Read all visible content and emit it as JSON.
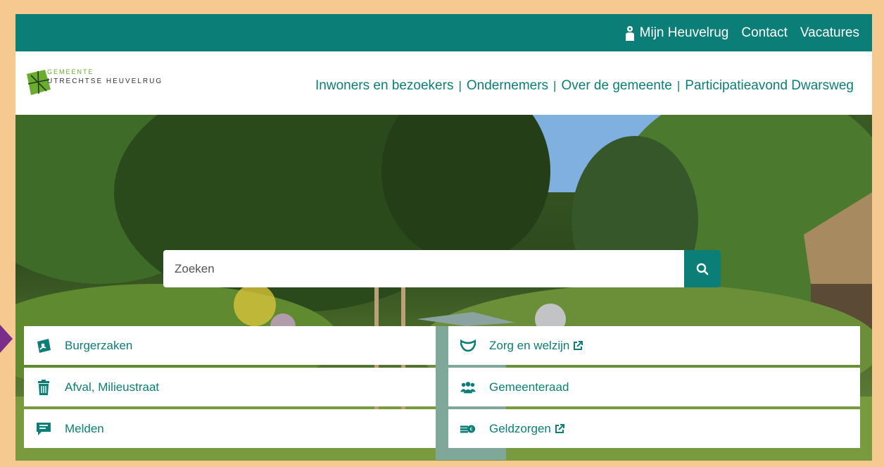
{
  "topbar": {
    "links": [
      "Mijn Heuvelrug",
      "Contact",
      "Vacatures"
    ]
  },
  "logo": {
    "line1": "GEMEENTE",
    "line2": "UTRECHTSE HEUVELRUG"
  },
  "mainnav": {
    "items": [
      "Inwoners en bezoekers",
      "Ondernemers",
      "Over de gemeente",
      "Participatieavond Dwarsweg"
    ]
  },
  "search": {
    "placeholder": "Zoeken"
  },
  "tiles": [
    {
      "label": "Burgerzaken",
      "icon": "id-card-icon",
      "external": false
    },
    {
      "label": "Zorg en welzijn",
      "icon": "care-hands-icon",
      "external": true
    },
    {
      "label": "Afval, Milieustraat",
      "icon": "trash-icon",
      "external": false
    },
    {
      "label": "Gemeenteraad",
      "icon": "people-group-icon",
      "external": false
    },
    {
      "label": "Melden",
      "icon": "message-icon",
      "external": false
    },
    {
      "label": "Geldzorgen",
      "icon": "money-icon",
      "external": true
    }
  ],
  "colors": {
    "brand": "#0b7e77",
    "logo_green": "#6bab2e",
    "frame": "#f5c990",
    "pointer": "#7a2e8a"
  }
}
